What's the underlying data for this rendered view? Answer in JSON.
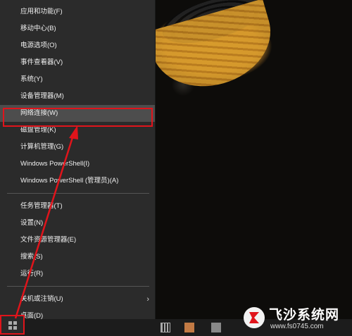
{
  "context_menu": {
    "items": [
      {
        "label": "应用和功能(F)"
      },
      {
        "label": "移动中心(B)"
      },
      {
        "label": "电源选项(O)"
      },
      {
        "label": "事件查看器(V)"
      },
      {
        "label": "系统(Y)"
      },
      {
        "label": "设备管理器(M)"
      },
      {
        "label": "网络连接(W)"
      },
      {
        "label": "磁盘管理(K)"
      },
      {
        "label": "计算机管理(G)"
      },
      {
        "label": "Windows PowerShell(I)"
      },
      {
        "label": "Windows PowerShell (管理员)(A)"
      },
      {
        "label": "任务管理器(T)"
      },
      {
        "label": "设置(N)"
      },
      {
        "label": "文件资源管理器(E)"
      },
      {
        "label": "搜索(S)"
      },
      {
        "label": "运行(R)"
      },
      {
        "label": "关机或注销(U)"
      },
      {
        "label": "桌面(D)"
      }
    ],
    "highlighted_item": "网络连接(W)",
    "submenu_arrow": "›"
  },
  "annotation_color": "#e0141b",
  "taskbar": {
    "icons": [
      "windows-start-icon",
      "calculator-icon",
      "app-icon",
      "app-icon"
    ]
  },
  "watermark": {
    "title": "飞沙系统网",
    "url": "www.fs0745.com"
  }
}
